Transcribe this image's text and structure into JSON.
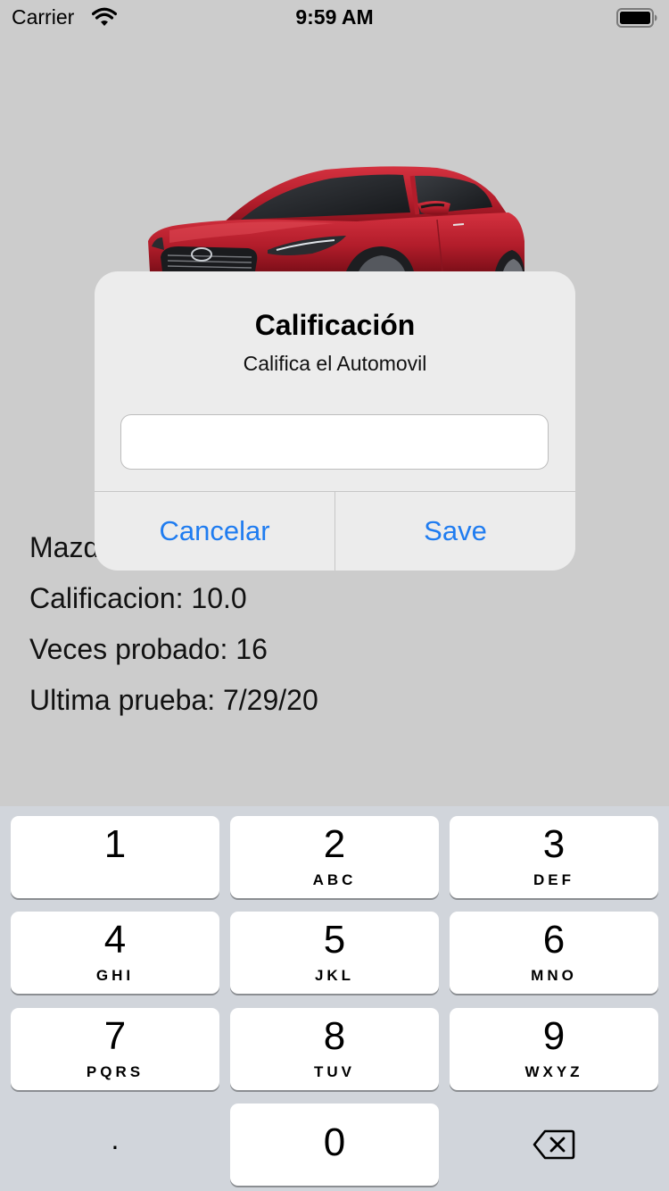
{
  "status_bar": {
    "carrier": "Carrier",
    "time": "9:59 AM"
  },
  "car": {
    "color": "#b31d2b"
  },
  "info": {
    "model_partial": "Mazda",
    "rating": "Calificacion: 10.0",
    "times_tested": "Veces probado: 16",
    "last_test": "Ultima prueba: 7/29/20"
  },
  "alert": {
    "title": "Calificación",
    "message": "Califica el Automovil",
    "input_value": "",
    "cancel_label": "Cancelar",
    "save_label": "Save",
    "accent_color": "#1f7cf0"
  },
  "keypad": {
    "keys": [
      {
        "digit": "1",
        "letters": ""
      },
      {
        "digit": "2",
        "letters": "ABC"
      },
      {
        "digit": "3",
        "letters": "DEF"
      },
      {
        "digit": "4",
        "letters": "GHI"
      },
      {
        "digit": "5",
        "letters": "JKL"
      },
      {
        "digit": "6",
        "letters": "MNO"
      },
      {
        "digit": "7",
        "letters": "PQRS"
      },
      {
        "digit": "8",
        "letters": "TUV"
      },
      {
        "digit": "9",
        "letters": "WXYZ"
      }
    ],
    "zero": "0",
    "dot": ".",
    "delete_icon": "delete-backspace-icon"
  }
}
